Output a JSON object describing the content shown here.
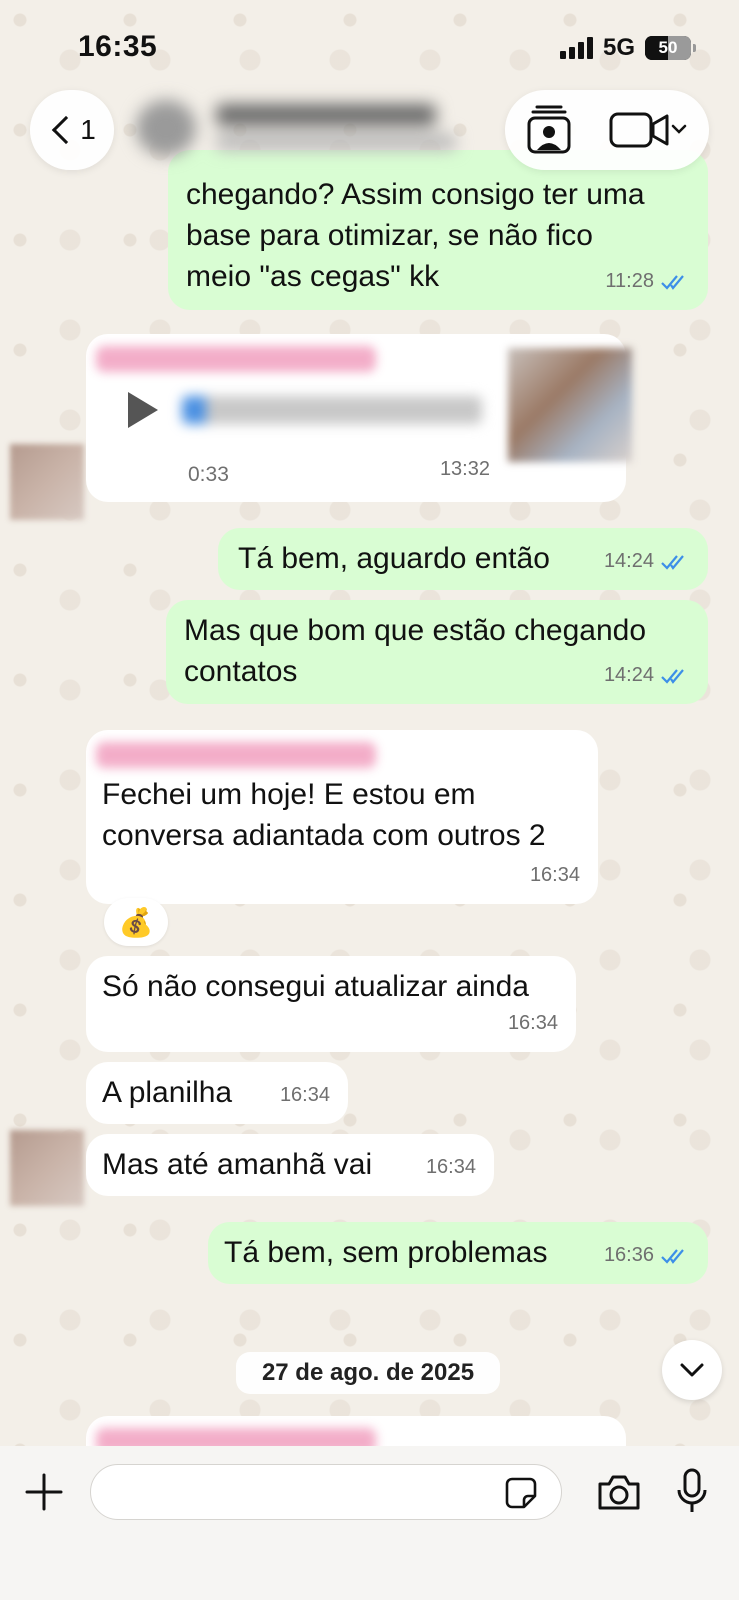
{
  "status_bar": {
    "time": "16:35",
    "network": "5G",
    "battery": "50"
  },
  "nav": {
    "back_count": "1"
  },
  "messages": [
    {
      "id": "m1",
      "direction": "outgoing",
      "lines": [
        "chegando? Assim consigo ter uma",
        "base para otimizar, se não fico",
        "meio \"as cegas\" kk"
      ],
      "time": "11:28",
      "read": true
    },
    {
      "id": "m2",
      "direction": "incoming",
      "type": "audio",
      "duration": "0:33",
      "time": "13:32"
    },
    {
      "id": "m3",
      "direction": "outgoing",
      "text": "Tá bem, aguardo então",
      "time": "14:24",
      "read": true
    },
    {
      "id": "m4",
      "direction": "outgoing",
      "lines": [
        "Mas que bom que estão chegando",
        "contatos"
      ],
      "time": "14:24",
      "read": true
    },
    {
      "id": "m5",
      "direction": "incoming",
      "lines": [
        "Fechei um hoje! E estou em",
        "conversa adiantada com outros 2"
      ],
      "time": "16:34",
      "reaction": "💰"
    },
    {
      "id": "m6",
      "direction": "incoming",
      "text": "Só não consegui atualizar ainda",
      "time": "16:34"
    },
    {
      "id": "m7",
      "direction": "incoming",
      "text": "A planilha",
      "time": "16:34"
    },
    {
      "id": "m8",
      "direction": "incoming",
      "text": "Mas até amanhã vai",
      "time": "16:34"
    },
    {
      "id": "m9",
      "direction": "outgoing",
      "text": "Tá bem, sem problemas",
      "time": "16:36",
      "read": true
    }
  ],
  "date_separator": "27 de ago. de 2025",
  "input": {
    "placeholder": ""
  },
  "colors": {
    "outgoing_bubble": "#d9fdd3",
    "incoming_bubble": "#ffffff",
    "read_ticks": "#3d8fe8",
    "background": "#f3efe8"
  },
  "icons": [
    "back-chevron-icon",
    "contact-card-icon",
    "video-call-icon",
    "chevron-down-icon",
    "play-icon",
    "plus-icon",
    "sticker-icon",
    "camera-icon",
    "microphone-icon",
    "double-check-icon"
  ]
}
